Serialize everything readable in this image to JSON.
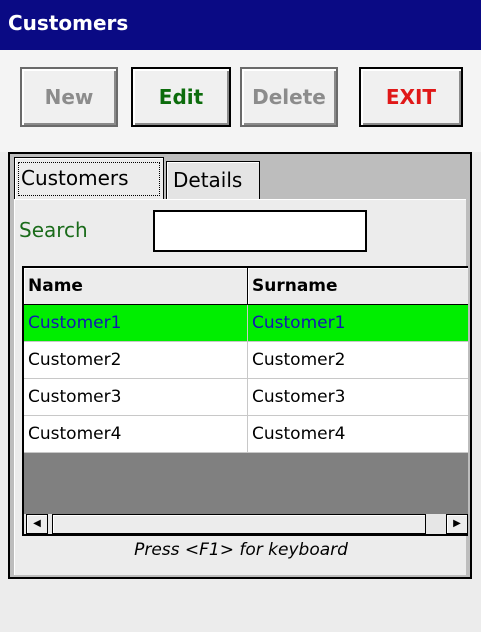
{
  "window": {
    "title": "Customers"
  },
  "toolbar": {
    "new_label": "New",
    "edit_label": "Edit",
    "delete_label": "Delete",
    "exit_label": "EXIT"
  },
  "tabs": [
    {
      "label": "Customers",
      "active": true
    },
    {
      "label": "Details",
      "active": false
    }
  ],
  "search": {
    "label": "Search",
    "value": ""
  },
  "grid": {
    "columns": [
      "Name",
      "Surname"
    ],
    "rows": [
      {
        "name": "Customer1",
        "surname": "Customer1",
        "selected": true
      },
      {
        "name": "Customer2",
        "surname": "Customer2",
        "selected": false
      },
      {
        "name": "Customer3",
        "surname": "Customer3",
        "selected": false
      },
      {
        "name": "Customer4",
        "surname": "Customer4",
        "selected": false
      }
    ]
  },
  "hint": "Press <F1> for keyboard",
  "icons": {
    "scroll_left": "left-arrow-icon",
    "scroll_right": "right-arrow-icon"
  },
  "colors": {
    "titlebar": "#0a0a84",
    "selected_row": "#00ee00",
    "selected_text": "#1414b4",
    "edit_text": "#0c6c0c",
    "exit_text": "#e01818",
    "disabled_text": "#8c8c8c",
    "search_label": "#1a6b1a"
  }
}
